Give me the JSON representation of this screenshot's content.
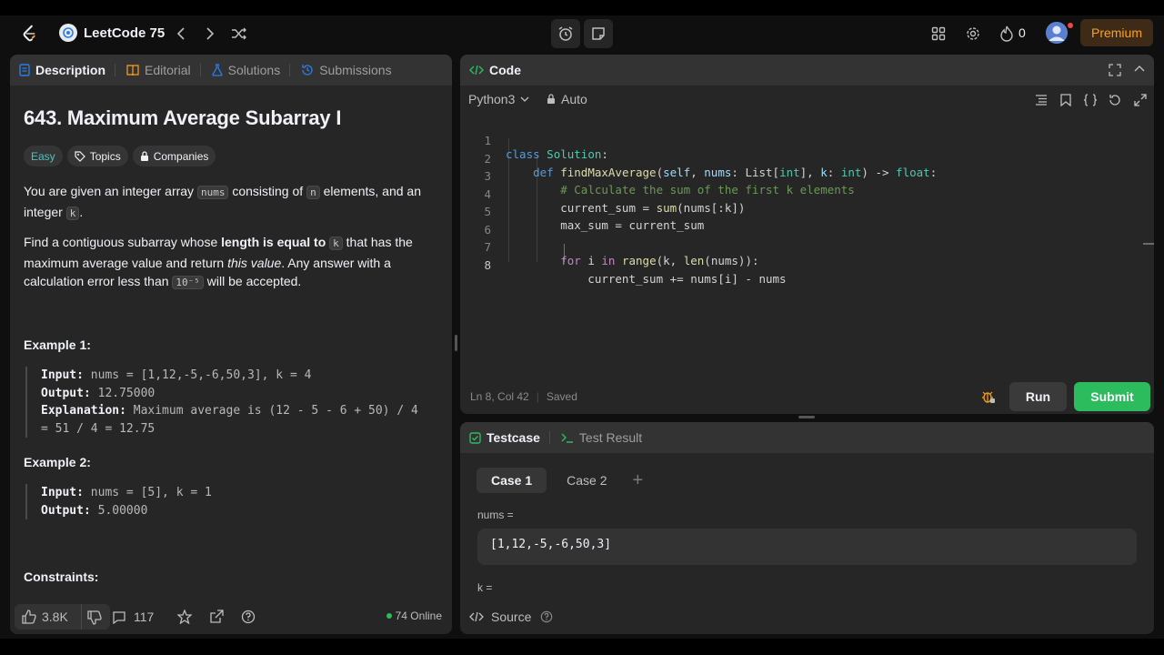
{
  "topnav": {
    "list_title": "LeetCode 75",
    "streak_count": "0",
    "premium_label": "Premium"
  },
  "left_panel": {
    "tabs": [
      {
        "label": "Description",
        "icon": "description-icon",
        "active": true
      },
      {
        "label": "Editorial",
        "icon": "editorial-icon",
        "active": false
      },
      {
        "label": "Solutions",
        "icon": "flask-icon",
        "active": false
      },
      {
        "label": "Submissions",
        "icon": "history-icon",
        "active": false
      }
    ],
    "problem_title": "643. Maximum Average Subarray I",
    "difficulty": "Easy",
    "topics_label": "Topics",
    "companies_label": "Companies",
    "para1": {
      "t1": "You are given an integer array ",
      "c1": "nums",
      "t2": " consisting of ",
      "c2": "n",
      "t3": " elements, and an integer ",
      "c3": "k",
      "t4": "."
    },
    "para2": {
      "t1": "Find a contiguous subarray whose ",
      "b1": "length is equal to",
      "t2": " ",
      "c1": "k",
      "t3": " that has the maximum average value and return ",
      "i1": "this value",
      "t4": ". Any answer with a calculation error less than ",
      "c2": "10⁻⁵",
      "t5": " will be accepted."
    },
    "examples": [
      {
        "title": "Example 1:",
        "input_label": "Input:",
        "input": " nums = [1,12,-5,-6,50,3], k = 4",
        "output_label": "Output:",
        "output": " 12.75000",
        "explanation_label": "Explanation:",
        "explanation_l1": " Maximum average is (12 - 5 - 6 + 50) / 4",
        "explanation_l2": "= 51 / 4 = 12.75"
      },
      {
        "title": "Example 2:",
        "input_label": "Input:",
        "input": " nums = [5], k = 1",
        "output_label": "Output:",
        "output": " 5.00000"
      }
    ],
    "constraints_title": "Constraints:",
    "footer": {
      "likes": "3.8K",
      "comments": "117",
      "online": "74 Online"
    }
  },
  "code_panel": {
    "title": "Code",
    "language": "Python3",
    "mode": "Auto",
    "lines": [
      "1",
      "2",
      "3",
      "4",
      "5",
      "6",
      "7",
      "8"
    ],
    "status_position": "Ln 8, Col 42",
    "status_saved": "Saved",
    "run_label": "Run",
    "submit_label": "Submit"
  },
  "test_panel": {
    "tab_testcase": "Testcase",
    "tab_result": "Test Result",
    "cases": [
      "Case 1",
      "Case 2"
    ],
    "add_case": "+",
    "var1_label": "nums =",
    "var1_value": "[1,12,-5,-6,50,3]",
    "var2_label": "k =",
    "source_label": "Source"
  },
  "colors": {
    "accent_green": "#2cbb5d",
    "easy": "#46c6c2",
    "premium": "#ffa116",
    "panel_bg": "#262626",
    "header_bg": "#333333"
  }
}
